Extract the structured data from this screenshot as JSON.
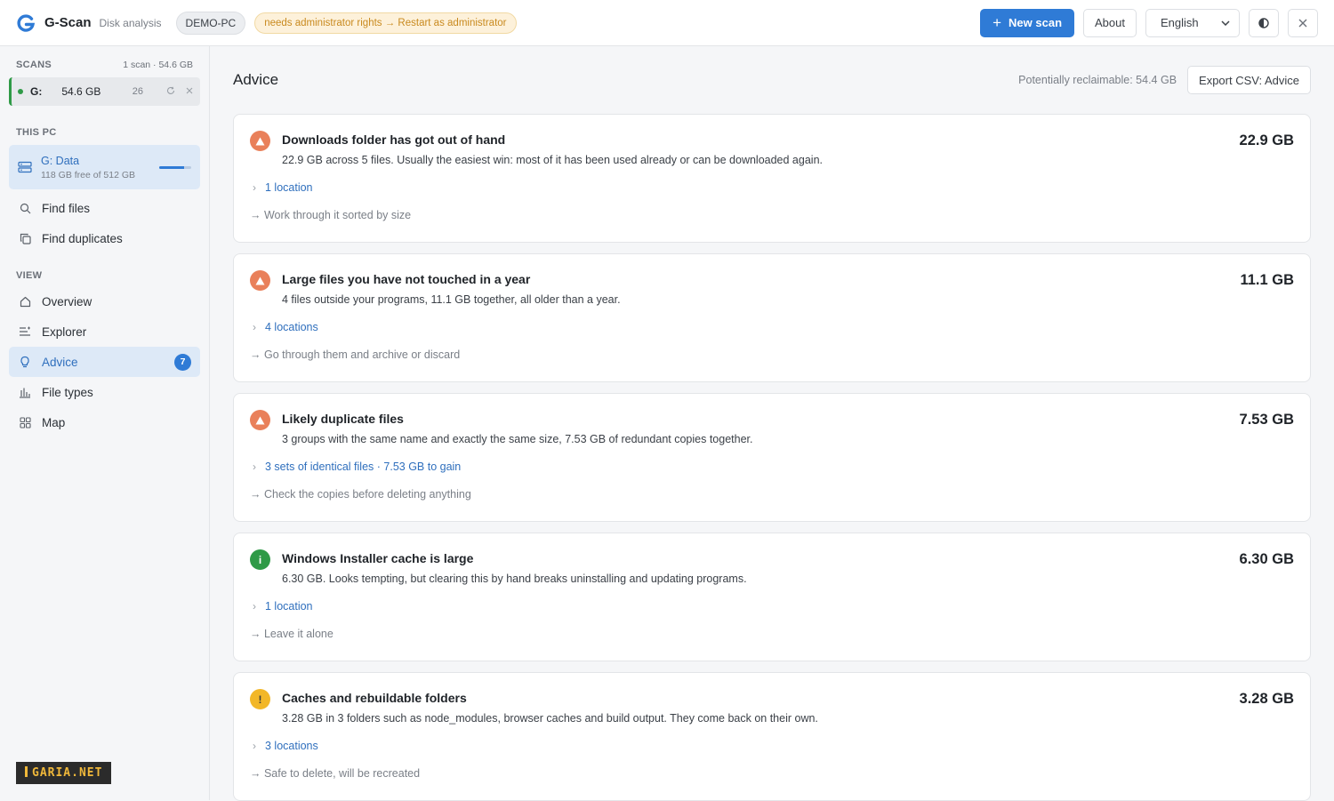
{
  "app": {
    "name": "G-Scan",
    "subtitle": "Disk analysis",
    "pc_name": "DEMO-PC",
    "admin_warning": "needs administrator rights → Restart as administrator"
  },
  "toolbar": {
    "new_scan_label": "New scan",
    "about_label": "About",
    "language": "English"
  },
  "sidebar": {
    "scans_heading": "SCANS",
    "scans_meta": "1 scan · 54.6 GB",
    "scan": {
      "drive": "G:",
      "size": "54.6 GB",
      "count": "26"
    },
    "this_pc_heading": "THIS PC",
    "drive_card": {
      "name": "G: Data",
      "free": "118 GB free of 512 GB",
      "used_fraction": 0.77
    },
    "tools": [
      {
        "label": "Find files",
        "icon": "search-icon"
      },
      {
        "label": "Find duplicates",
        "icon": "copy-icon"
      }
    ],
    "view_heading": "VIEW",
    "views": [
      {
        "label": "Overview",
        "icon": "home-icon"
      },
      {
        "label": "Explorer",
        "icon": "list-icon"
      },
      {
        "label": "Advice",
        "icon": "lightbulb-icon",
        "badge": "7",
        "active": true
      },
      {
        "label": "File types",
        "icon": "bar-chart-icon"
      },
      {
        "label": "Map",
        "icon": "grid-icon"
      }
    ],
    "watermark": "GARIA.NET"
  },
  "main": {
    "title": "Advice",
    "reclaimable": "Potentially reclaimable: 54.4 GB",
    "export_label": "Export CSV: Advice",
    "cards": [
      {
        "severity": "warning",
        "color": "#e9805a",
        "title": "Downloads folder has got out of hand",
        "desc": "22.9 GB across 5 files. Usually the easiest win: most of it has been used already or can be downloaded again.",
        "size": "22.9 GB",
        "location": "1 location",
        "action": "→ Work through it sorted by size"
      },
      {
        "severity": "warning",
        "color": "#e9805a",
        "title": "Large files you have not touched in a year",
        "desc": "4 files outside your programs, 11.1 GB together, all older than a year.",
        "size": "11.1 GB",
        "location": "4 locations",
        "action": "→ Go through them and archive or discard"
      },
      {
        "severity": "warning",
        "color": "#e9805a",
        "title": "Likely duplicate files",
        "desc": "3 groups with the same name and exactly the same size, 7.53 GB of redundant copies together.",
        "size": "7.53 GB",
        "location": "3 sets of identical files · 7.53 GB to gain",
        "action": "→ Check the copies before deleting anything"
      },
      {
        "severity": "info",
        "color": "#2f9a47",
        "title": "Windows Installer cache is large",
        "desc": "6.30 GB. Looks tempting, but clearing this by hand breaks uninstalling and updating programs.",
        "size": "6.30 GB",
        "location": "1 location",
        "action": "→ Leave it alone"
      },
      {
        "severity": "notice",
        "color": "#f2b728",
        "title": "Caches and rebuildable folders",
        "desc": "3.28 GB in 3 folders such as node_modules, browser caches and build output. They come back on their own.",
        "size": "3.28 GB",
        "location": "3 locations",
        "action": "→ Safe to delete, will be recreated"
      }
    ]
  }
}
